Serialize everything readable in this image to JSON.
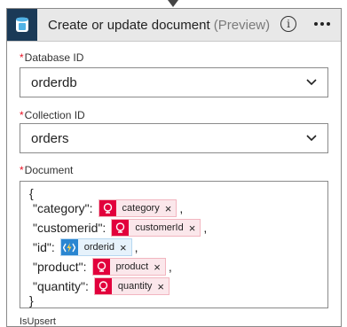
{
  "action": {
    "title": "Create or update document",
    "preview": "(Preview)",
    "info_symbol": "i"
  },
  "fields": {
    "database": {
      "label": "Database ID",
      "required_mark": "*",
      "value": "orderdb"
    },
    "collection": {
      "label": "Collection ID",
      "required_mark": "*",
      "value": "orders"
    },
    "document": {
      "label": "Document",
      "required_mark": "*",
      "open_brace": "{",
      "close_brace": "}",
      "lines": [
        {
          "key": "\"category\":",
          "token": "category",
          "token_kind": "sql",
          "trailing": ","
        },
        {
          "key": "\"customerid\":",
          "token": "customerId",
          "token_kind": "sql",
          "trailing": ","
        },
        {
          "key": "\"id\":",
          "token": "orderid",
          "token_kind": "function",
          "trailing": ","
        },
        {
          "key": "\"product\":",
          "token": "product",
          "token_kind": "sql",
          "trailing": ","
        },
        {
          "key": "\"quantity\":",
          "token": "quantity",
          "token_kind": "sql",
          "trailing": ""
        }
      ]
    },
    "next_label_partial": "IsUpsert"
  },
  "icons": {
    "header": "cosmos-db-icon",
    "info": "info-icon",
    "menu": "more-options-icon",
    "dropdown": "chevron-down-icon",
    "token_sql": "sql-connector-icon",
    "token_function": "azure-function-icon",
    "remove": "remove-token-icon"
  },
  "colors": {
    "header_bg": "#e8e8e8",
    "brand_tile": "#1b3a57",
    "required": "#e81123",
    "sql_token_icon": "#e2003c",
    "function_token_icon": "#2a86d1"
  }
}
